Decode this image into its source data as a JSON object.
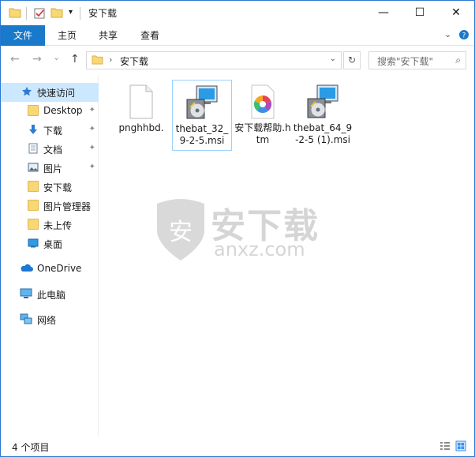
{
  "window": {
    "title": "安下载",
    "minimize": "—",
    "maximize": "☐",
    "close": "✕"
  },
  "ribbon": {
    "tabs": [
      "文件",
      "主页",
      "共享",
      "查看"
    ],
    "expand_icon": "chevron-down",
    "help_icon": "help"
  },
  "address": {
    "back": "←",
    "forward": "→",
    "recent": "⌄",
    "up": "↑",
    "path_arrow": "›",
    "path": "安下载",
    "dropdown": "⌄",
    "refresh": "↻"
  },
  "search": {
    "placeholder": "搜索\"安下载\"",
    "icon": "⌕"
  },
  "sidebar": {
    "items": [
      {
        "label": "快速访问",
        "icon": "star-icon"
      },
      {
        "label": "Desktop",
        "icon": "folder-icon",
        "pinned": true
      },
      {
        "label": "下载",
        "icon": "download-icon",
        "pinned": true
      },
      {
        "label": "文档",
        "icon": "document-icon",
        "pinned": true
      },
      {
        "label": "图片",
        "icon": "picture-icon",
        "pinned": true
      },
      {
        "label": "安下载",
        "icon": "folder-icon"
      },
      {
        "label": "图片管理器",
        "icon": "folder-icon"
      },
      {
        "label": "未上传",
        "icon": "folder-icon"
      },
      {
        "label": "桌面",
        "icon": "desktop-icon"
      },
      {
        "label": "OneDrive",
        "icon": "cloud-icon"
      },
      {
        "label": "此电脑",
        "icon": "computer-icon"
      },
      {
        "label": "网络",
        "icon": "network-icon"
      }
    ],
    "pin_glyph": "📌"
  },
  "files": [
    {
      "name": "pnghhbd.",
      "type": "blank-file"
    },
    {
      "name": "thebat_32_9-2-5.msi",
      "type": "installer",
      "selected": true
    },
    {
      "name": "安下载帮助.htm",
      "type": "htm"
    },
    {
      "name": "thebat_64_9-2-5 (1).msi",
      "type": "installer"
    }
  ],
  "watermark": {
    "text": "安下载",
    "subtext": "anxz.com"
  },
  "status": {
    "count": "4 个项目"
  },
  "colors": {
    "accent": "#1979ca",
    "selection": "#cce8ff",
    "folder": "#f8d775"
  }
}
